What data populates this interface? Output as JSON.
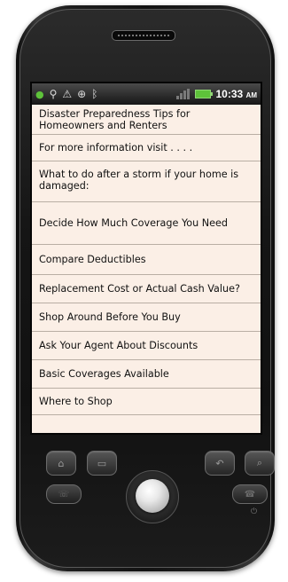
{
  "status_bar": {
    "time": "10:33",
    "ampm": "AM",
    "icons": [
      "notification-icon",
      "usb-icon",
      "warning-icon",
      "gps-icon",
      "bluetooth-icon",
      "signal-icon",
      "battery-icon"
    ]
  },
  "list": {
    "items": [
      "Disaster Preparedness Tips for Homeowners and Renters",
      "For more information visit . . . .",
      "What to do after a storm if your home is damaged:",
      "Decide How Much Coverage You Need",
      "Compare Deductibles",
      "Replacement Cost or Actual Cash Value?",
      "Shop Around Before You Buy",
      "Ask Your Agent About Discounts",
      "Basic Coverages Available",
      "Where to Shop"
    ]
  },
  "colors": {
    "list_background": "#fbefe6",
    "divider": "#b9aea4",
    "phone_body": "#151515"
  }
}
